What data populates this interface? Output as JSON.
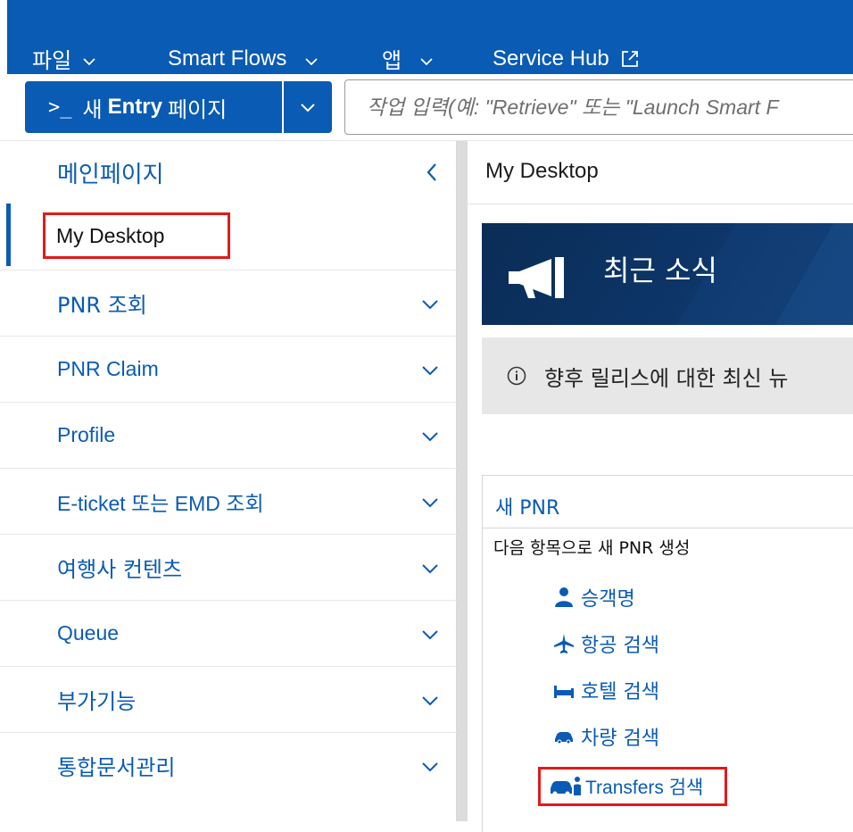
{
  "topnav": {
    "file": "파일",
    "smart_flows": "Smart Flows",
    "apps": "앱",
    "service_hub": "Service Hub"
  },
  "entry": {
    "prompt_symbol": ">_",
    "prefix": "새",
    "bold": "Entry",
    "suffix": "페이지",
    "placeholder": "작업 입력(예: \"Retrieve\" 또는 \"Launch Smart F"
  },
  "sidebar": {
    "header": "메인페이지",
    "active": "My Desktop",
    "items": [
      {
        "label": "PNR 조회"
      },
      {
        "label": "PNR Claim"
      },
      {
        "label": "Profile"
      },
      {
        "label": "E-ticket 또는 EMD 조회"
      },
      {
        "label": "여행사 컨텐츠"
      },
      {
        "label": "Queue"
      },
      {
        "label": "부가기능"
      },
      {
        "label": "통합문서관리"
      }
    ]
  },
  "main": {
    "title": "My Desktop",
    "news_title": "최근 소식",
    "info_text": "향후 릴리스에 대한 최신 뉴",
    "pnr_title": "새 PNR",
    "pnr_subtitle": "다음 항목으로 새 PNR 생성",
    "options": [
      {
        "label": "승객명",
        "icon": "person-icon"
      },
      {
        "label": "항공 검색",
        "icon": "plane-icon"
      },
      {
        "label": "호텔 검색",
        "icon": "bed-icon"
      },
      {
        "label": "차량 검색",
        "icon": "car-icon"
      }
    ],
    "transfer_label": "Transfers 검색"
  },
  "colors": {
    "brand_blue": "#0a5bb4",
    "highlight_red": "#e11a1a"
  }
}
